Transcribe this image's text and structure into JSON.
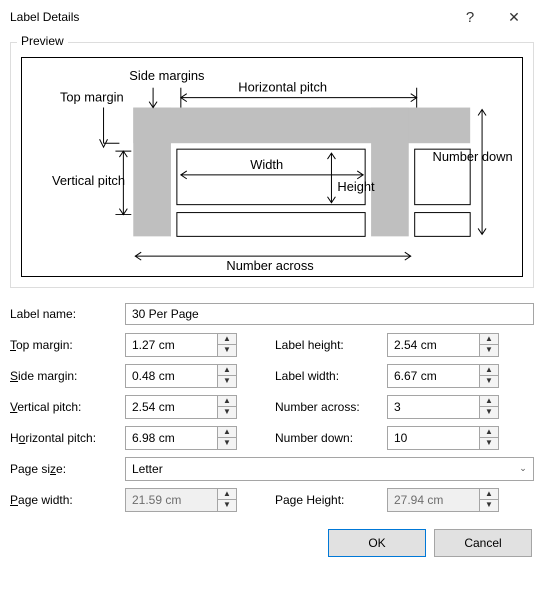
{
  "title": "Label Details",
  "preview": {
    "label": "Preview",
    "annotations": [
      "Side margins",
      "Top margin",
      "Horizontal pitch",
      "Vertical pitch",
      "Width",
      "Height",
      "Number down",
      "Number across"
    ]
  },
  "fields": {
    "label_name": {
      "label": "Label name:",
      "value": "30 Per Page"
    },
    "top_margin": {
      "label": "op margin:",
      "value": "1.27 cm"
    },
    "side_margin": {
      "label": "ide margin:",
      "value": "0.48 cm"
    },
    "vertical_pitch": {
      "label": "ertical pitch:",
      "value": "2.54 cm"
    },
    "horizontal_pitch": {
      "label": "rizontal pitch:",
      "value": "6.98 cm"
    },
    "label_height": {
      "label": "Label height:",
      "value": "2.54 cm"
    },
    "label_width": {
      "label": "Label width:",
      "value": "6.67 cm"
    },
    "number_across": {
      "label": "Number across:",
      "value": "3"
    },
    "number_down": {
      "label": "Number down:",
      "value": "10"
    },
    "page_size": {
      "label": "Page size:",
      "value": "Letter"
    },
    "page_width": {
      "label": "age width:",
      "value": "21.59 cm",
      "disabled": true
    },
    "page_height": {
      "label": "Page Height:",
      "value": "27.94 cm",
      "disabled": true
    }
  },
  "buttons": {
    "ok": "OK",
    "cancel": "Cancel"
  }
}
